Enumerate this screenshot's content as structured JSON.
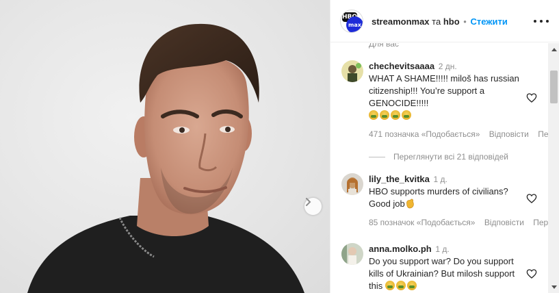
{
  "post": {
    "image_alt": "portrait photo"
  },
  "header": {
    "username": "streamonmax",
    "separator": "та",
    "coauthor": "hbo",
    "dot": "•",
    "follow_label": "Стежити",
    "more_icon": "more-horizontal-icon",
    "avatar_top_text": "HBO",
    "avatar_bottom_text": "max"
  },
  "cut_text": "Для вас",
  "comments": [
    {
      "username": "chechevitsaaaa",
      "time": "2 дн.",
      "text": "WHAT A SHAME!!!!! miloš has russian citizenship!!! You’re support a GENOCIDE!!!!!",
      "emoji_count": 4,
      "likes": "471 позначка «Подобається»",
      "reply_label": "Відповісти",
      "extra_label": "Пе",
      "view_replies": "Переглянути всі 21 відповідей"
    },
    {
      "username": "lily_the_kvitka",
      "time": "1 д.",
      "text": "HBO supports murders of civilians? Good job",
      "likes": "85 позначок «Подобається»",
      "reply_label": "Відповісти",
      "extra_label": "Пер"
    },
    {
      "username": "anna.molko.ph",
      "time": "1 д.",
      "text": "Do you support war? Do you support kills of Ukrainian? But milosh support this",
      "emoji_count": 3
    }
  ],
  "colors": {
    "accent": "#0095f6",
    "text": "#262626",
    "muted": "#8e8e8e",
    "hbo_blue": "#1d2bd8"
  }
}
